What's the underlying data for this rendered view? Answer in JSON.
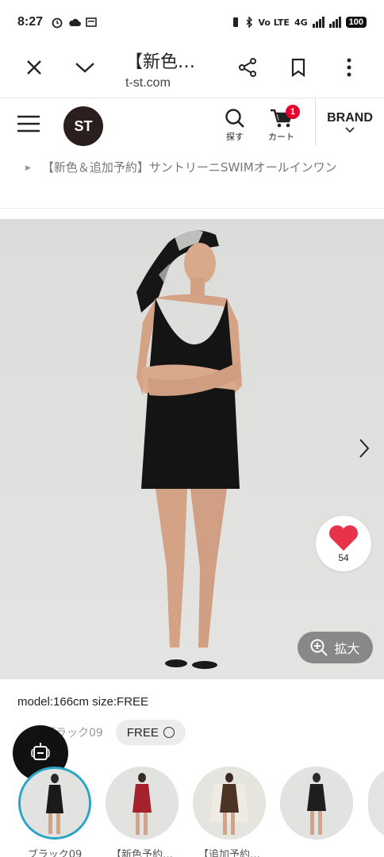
{
  "status": {
    "time": "8:27",
    "network": "Vo LTE",
    "signal_label": "4G",
    "battery": "100"
  },
  "browser": {
    "title": "【新色…",
    "url": "t-st.com"
  },
  "header": {
    "logo": "ST",
    "search_label": "探す",
    "cart_label": "カート",
    "cart_count": "1",
    "brand_label": "BRAND"
  },
  "breadcrumb": {
    "current": "【新色＆追加予約】サントリーニSWIMオールインワン"
  },
  "product": {
    "like_count": "54",
    "zoom_label": "拡大",
    "model_info": "model:166cm size:FREE",
    "variant_name": "ブラック09",
    "size_label": "FREE",
    "colors": {
      "accent": "#29a3c7",
      "heart": "#e8324a",
      "badge": "#e4002b"
    }
  },
  "thumbnails": [
    {
      "label": "ブラック09",
      "color": "#1a1a1a"
    },
    {
      "label": "【新色予約…",
      "color": "#a3222b"
    },
    {
      "label": "【追加予約…",
      "color": "#4b3426"
    },
    {
      "label": "",
      "color": "#1e1e1e"
    }
  ]
}
